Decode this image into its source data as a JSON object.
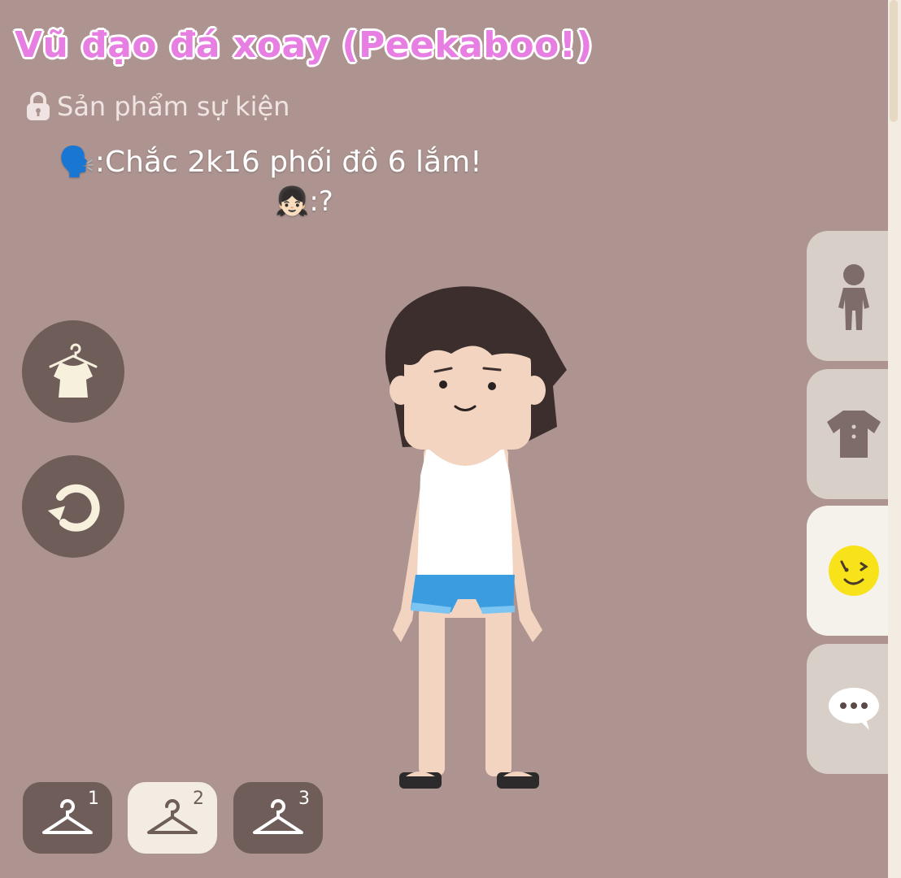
{
  "header": {
    "title": "Vũ đạo đá xoay (Peekaboo!)",
    "subtitle": "Sản phẩm sự kiện",
    "lock_icon": "lock-icon"
  },
  "captions": {
    "line1_emoji": "🗣️",
    "line1_text": ":Chắc 2k16 phối đồ 6 lắm!",
    "line2_emoji": "👧🏻",
    "line2_text": ":?"
  },
  "left_controls": [
    {
      "icon": "outfit-hanger-icon"
    },
    {
      "icon": "rotate-icon"
    }
  ],
  "side_tabs": [
    {
      "icon": "body-icon",
      "active": false
    },
    {
      "icon": "clothing-icon",
      "active": false
    },
    {
      "icon": "emote-face-icon",
      "active": true
    },
    {
      "icon": "chat-bubble-icon",
      "active": false
    }
  ],
  "outfit_slots": [
    {
      "number": "1",
      "active": false
    },
    {
      "number": "2",
      "active": true
    },
    {
      "number": "3",
      "active": false
    }
  ],
  "colors": {
    "background": "#ad9491",
    "title": "#e77fe2",
    "button_dark": "#6f5d5a",
    "tab_light": "#d7cfc8",
    "tab_active": "#f5f2ec",
    "emote_yellow": "#f8e21a"
  }
}
